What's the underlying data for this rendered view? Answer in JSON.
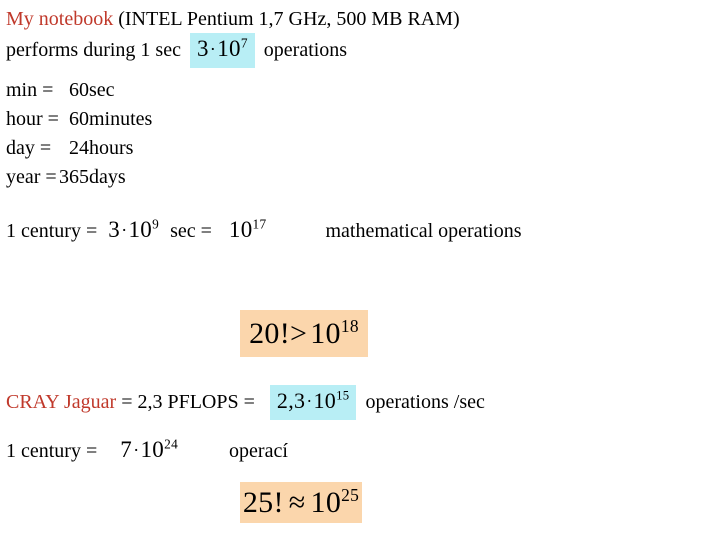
{
  "slide": {
    "intro": {
      "device_label": "My notebook",
      "device_spec": " (INTEL Pentium 1,7 GHz, 500 MB RAM)",
      "performs_prefix": "performs during 1 sec",
      "performs_value_mantissa": "3",
      "performs_value_dot": "·",
      "performs_value_base": "10",
      "performs_value_exp": "7",
      "performs_suffix": "operations"
    },
    "units_table": {
      "rows": [
        {
          "name": "min =",
          "value": "60",
          "unit": "sec"
        },
        {
          "name": "hour =",
          "value": "60",
          "unit": "minutes"
        },
        {
          "name": "day =",
          "value": "24",
          "unit": "hours"
        },
        {
          "name": "year =",
          "value": "365",
          "unit": "days"
        }
      ]
    },
    "century_seconds": {
      "label": "1 century =",
      "mantissa": "3",
      "dot": "·",
      "base": "10",
      "exp": "9",
      "unit": "sec  =",
      "result_base": "10",
      "result_exp": "17",
      "result_caption": "mathematical operations"
    },
    "box_factorial_20": {
      "left": "20!",
      "relation": ">",
      "base": "10",
      "exp": "18"
    },
    "cray": {
      "label": "CRAY Jaguar",
      "equals_flops": "= 2,3 PFLOPS =",
      "mantissa": "2,3",
      "dot": "·",
      "base": "10",
      "exp": "15",
      "suffix": "operations /sec"
    },
    "century_ops": {
      "label": "1 century =",
      "mantissa": "7",
      "dot": "·",
      "base": "10",
      "exp": "24",
      "caption": "operací"
    },
    "box_factorial_25": {
      "left": "25!",
      "relation": "≈",
      "base": "10",
      "exp": "25"
    },
    "colors": {
      "accent": "#C0392B",
      "highlight_cyan": "#B8EEF5",
      "highlight_peach": "#FBD6AC",
      "text": "#000000",
      "background": "#FFFFFF"
    }
  }
}
